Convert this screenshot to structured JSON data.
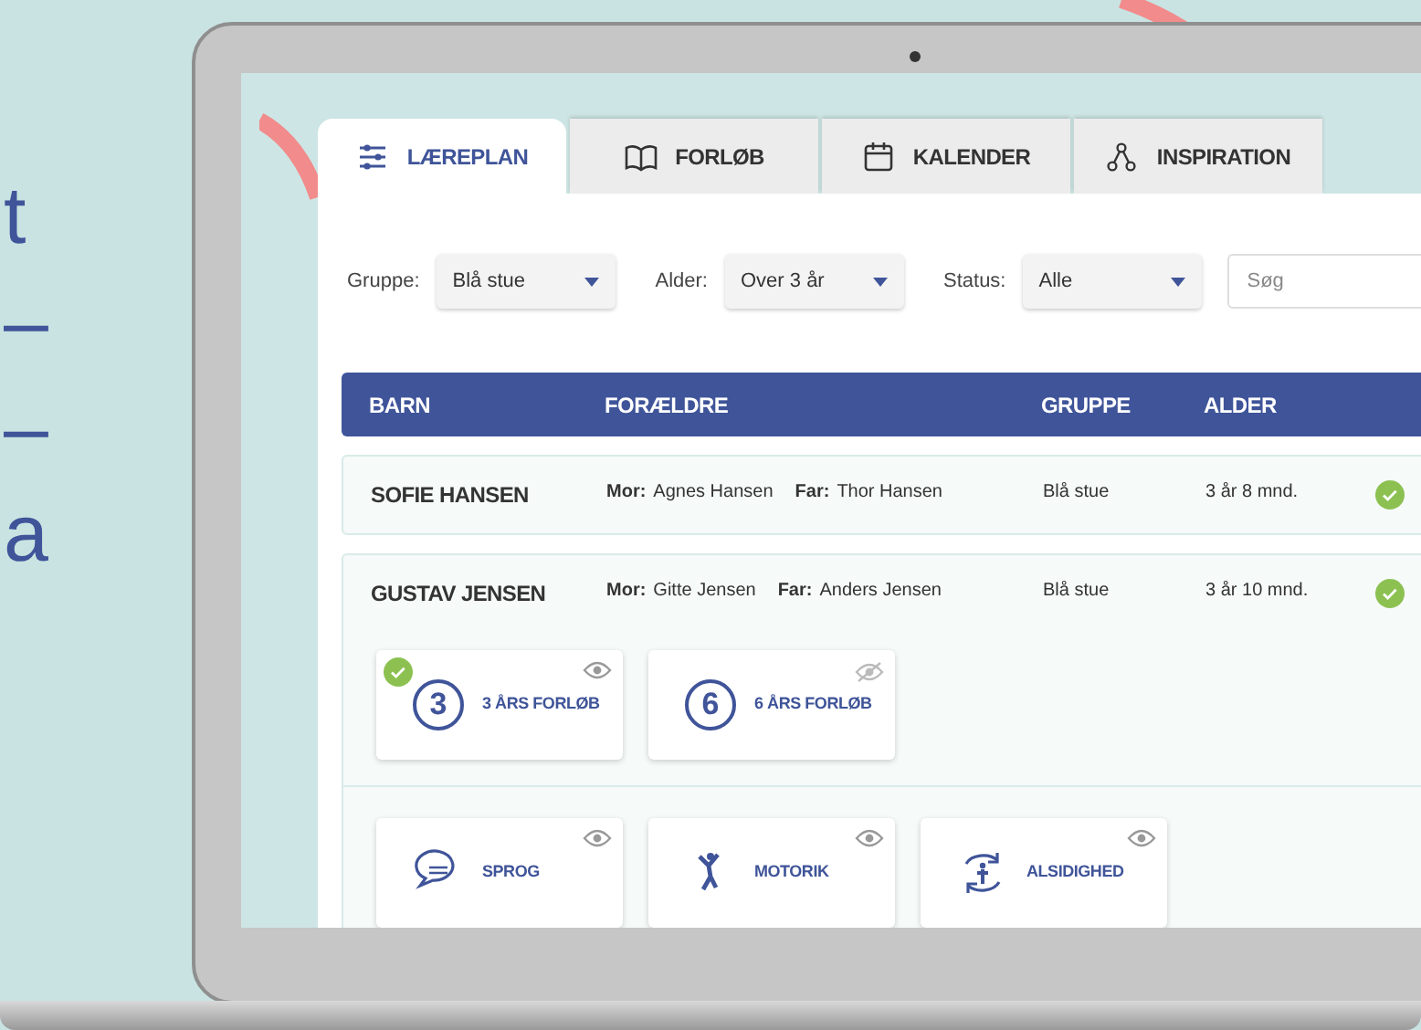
{
  "side_text": [
    "t",
    "–",
    "–",
    "a"
  ],
  "tabs": [
    {
      "label": "LÆREPLAN",
      "kind": "sliders",
      "selected": true
    },
    {
      "label": "FORLØB",
      "kind": "book",
      "selected": false
    },
    {
      "label": "KALENDER",
      "kind": "calendar",
      "selected": false
    },
    {
      "label": "INSPIRATION",
      "kind": "network",
      "selected": false
    }
  ],
  "filters": [
    {
      "label": "Gruppe:",
      "value": "Blå stue"
    },
    {
      "label": "Alder:",
      "value": "Over 3 år"
    },
    {
      "label": "Status:",
      "value": "Alle"
    }
  ],
  "search": {
    "placeholder": "Søg"
  },
  "table": {
    "columns": [
      "BARN",
      "FORÆLDRE",
      "GRUPPE",
      "ALDER"
    ],
    "rows": [
      {
        "name": "SOFIE HANSEN",
        "mother_label": "Mor:",
        "mother": "Agnes Hansen",
        "father_label": "Far:",
        "father": "Thor Hansen",
        "group": "Blå stue",
        "age": "3 år 8 mnd.",
        "done": true
      },
      {
        "name": "GUSTAV JENSEN",
        "mother_label": "Mor:",
        "mother": "Gitte Jensen",
        "father_label": "Far:",
        "father": "Anders Jensen",
        "group": "Blå stue",
        "age": "3 år 10 mnd.",
        "done": true,
        "courses": [
          {
            "number": "3",
            "label": "3 ÅRS FORLØB",
            "checked": true,
            "visible": true
          },
          {
            "number": "6",
            "label": "6 ÅRS FORLØB",
            "checked": false,
            "visible": false
          }
        ],
        "themes": [
          {
            "kind": "speech",
            "label": "SPROG",
            "visible": true
          },
          {
            "kind": "motor",
            "label": "MOTORIK",
            "visible": true
          },
          {
            "kind": "versatility",
            "label": "ALSIDIGHED",
            "visible": true
          }
        ]
      }
    ]
  }
}
